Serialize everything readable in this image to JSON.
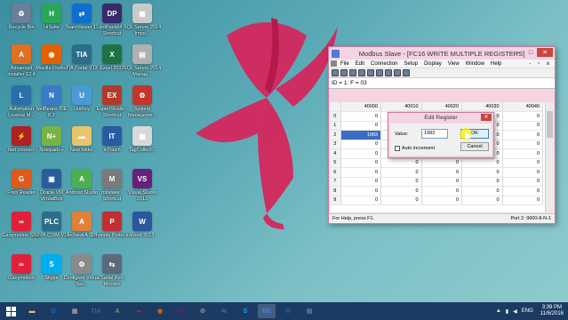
{
  "desktop": {
    "icons": [
      {
        "label": "Recycle Bin",
        "icon": "recycle-bin-icon",
        "color": "#6a7f98",
        "glyph": "♻"
      },
      {
        "label": "HiSuite",
        "icon": "hisuite-icon",
        "color": "#2aa55a",
        "glyph": "H"
      },
      {
        "label": "TeamViewer 11",
        "icon": "teamviewer-icon",
        "color": "#0e6fd1",
        "glyph": "⇄"
      },
      {
        "label": "dotPeek64 - Shortcut",
        "icon": "dotpeek-icon",
        "color": "#3a2a6a",
        "glyph": "DP"
      },
      {
        "label": "SQL Server 2014 Impo...",
        "icon": "sql-server-icon",
        "color": "#c9c9c9",
        "glyph": "▦"
      },
      {
        "label": "Advanced Installer 12.4",
        "icon": "advanced-installer-icon",
        "color": "#e07020",
        "glyph": "A"
      },
      {
        "label": "Mozilla Firefox",
        "icon": "firefox-icon",
        "color": "#e66000",
        "glyph": "◉"
      },
      {
        "label": "TIA Portal V13",
        "icon": "tia-portal-icon",
        "color": "#2d6d8a",
        "glyph": "TIA"
      },
      {
        "label": "Excel 2013",
        "icon": "excel-icon",
        "color": "#207245",
        "glyph": "X"
      },
      {
        "label": "SQL Server 2014 Manag...",
        "icon": "sql-management-icon",
        "color": "#b0b0b0",
        "glyph": "▤"
      },
      {
        "label": "Automation License M...",
        "icon": "automation-license-icon",
        "color": "#2b6fa8",
        "glyph": "L"
      },
      {
        "label": "NetBeans IDE 8.2",
        "icon": "netbeans-icon",
        "color": "#3a7bc8",
        "glyph": "N"
      },
      {
        "label": "UniKey",
        "icon": "unikey-icon",
        "color": "#4a9ad8",
        "glyph": "U"
      },
      {
        "label": "ExpertStudio - Shortcut",
        "icon": "expertstudio-icon",
        "color": "#b33a2a",
        "glyph": "EX"
      },
      {
        "label": "System Manageme...",
        "icon": "system-management-icon",
        "color": "#c4352c",
        "glyph": "⚙"
      },
      {
        "label": "fast connect",
        "icon": "fast-connect-icon",
        "color": "#b02020",
        "glyph": "⚡"
      },
      {
        "label": "Notepad++",
        "icon": "notepad-plus-icon",
        "color": "#79b346",
        "glyph": "N+"
      },
      {
        "label": "New folder",
        "icon": "folder-icon",
        "color": "#e9c46a",
        "glyph": "▬"
      },
      {
        "label": "InTouch",
        "icon": "intouch-icon",
        "color": "#2a5aa0",
        "glyph": "IT"
      },
      {
        "label": "TagCollect...",
        "icon": "tagcollect-icon",
        "color": "#d8d8d8",
        "glyph": "▦"
      },
      {
        "label": "Foxit Reader",
        "icon": "foxit-reader-icon",
        "color": "#e05a1c",
        "glyph": "G"
      },
      {
        "label": "Oracle VM VirtualBox",
        "icon": "virtualbox-icon",
        "color": "#2b5c9a",
        "glyph": "▣"
      },
      {
        "label": "Android Studio",
        "icon": "android-studio-icon",
        "color": "#4caf50",
        "glyph": "A"
      },
      {
        "label": "mbslave - Shortcut",
        "icon": "mbslave-icon",
        "color": "#7a7a7a",
        "glyph": "M"
      },
      {
        "label": "Visual Studio 2013",
        "icon": "visual-studio-icon",
        "color": "#68217a",
        "glyph": "VS"
      },
      {
        "label": "Ganymotion Shell",
        "icon": "genymotion-shell-icon",
        "color": "#e0203a",
        "glyph": "∞"
      },
      {
        "label": "S7-PLCSIM V13",
        "icon": "plcsim-icon",
        "color": "#2d6d8a",
        "glyph": "PLC"
      },
      {
        "label": "ArchestrA IDE",
        "icon": "archestra-icon",
        "color": "#e0803a",
        "glyph": "A"
      },
      {
        "label": "Phoenix Protector",
        "icon": "phoenix-protector-icon",
        "color": "#c03030",
        "glyph": "P"
      },
      {
        "label": "Word 2013",
        "icon": "word-icon",
        "color": "#2b579a",
        "glyph": "W"
      },
      {
        "label": "Ganymotion",
        "icon": "genymotion-icon",
        "color": "#e0203a",
        "glyph": "∞"
      },
      {
        "label": "Skype",
        "icon": "skype-icon",
        "color": "#00aff0",
        "glyph": "S"
      },
      {
        "label": "Configure Virtual Ser...",
        "icon": "configure-virtual-serial-icon",
        "color": "#8a8a8a",
        "glyph": "⚙"
      },
      {
        "label": "Serial Port Monitor",
        "icon": "serial-port-monitor-icon",
        "color": "#5a6a7a",
        "glyph": "⇆"
      }
    ]
  },
  "modbus": {
    "title": "Modbus Slave - [FC16 WRITE MULTIPLE REGISTERS]",
    "menu": [
      "File",
      "Edit",
      "Connection",
      "Setup",
      "Display",
      "View",
      "Window",
      "Help"
    ],
    "window_buttons": "- ▫ x",
    "id_line": "ID = 1: F = 03",
    "columns": [
      "40000",
      "40010",
      "40020",
      "40030",
      "40040"
    ],
    "rows": [
      {
        "index": "0",
        "values": [
          "0",
          "0",
          "0",
          "0",
          "0"
        ]
      },
      {
        "index": "1",
        "values": [
          "0",
          "0",
          "0",
          "0",
          "0"
        ]
      },
      {
        "index": "2",
        "values": [
          "1983",
          "0",
          "0",
          "0",
          "0"
        ]
      },
      {
        "index": "3",
        "values": [
          "0",
          "0",
          "0",
          "0",
          "0"
        ]
      },
      {
        "index": "4",
        "values": [
          "0",
          "0",
          "0",
          "0",
          "0"
        ]
      },
      {
        "index": "5",
        "values": [
          "0",
          "0",
          "0",
          "0",
          "0"
        ]
      },
      {
        "index": "6",
        "values": [
          "0",
          "0",
          "0",
          "0",
          "0"
        ]
      },
      {
        "index": "7",
        "values": [
          "0",
          "0",
          "0",
          "0",
          "0"
        ]
      },
      {
        "index": "8",
        "values": [
          "0",
          "0",
          "0",
          "0",
          "0"
        ]
      },
      {
        "index": "9",
        "values": [
          "0",
          "0",
          "0",
          "0",
          "0"
        ]
      }
    ],
    "status_left": "For Help, press F1.",
    "status_right": "Port 2: 9600-8-N-1"
  },
  "dialog": {
    "title": "Edit Register",
    "value_label": "Value:",
    "value": "1983",
    "ok_label": "OK",
    "cancel_label": "Cancel",
    "auto_increment_label": "Auto increment"
  },
  "taskbar": {
    "apps": [
      {
        "icon": "file-explorer-icon",
        "glyph": "▬",
        "color": "#e9c46a"
      },
      {
        "icon": "outlook-icon",
        "glyph": "O",
        "color": "#0072c6"
      },
      {
        "icon": "sql-server-icon",
        "glyph": "▦",
        "color": "#999"
      },
      {
        "icon": "tia-portal-icon",
        "glyph": "TIA",
        "color": "#2d6d8a"
      },
      {
        "icon": "android-studio-icon",
        "glyph": "A",
        "color": "#4caf50"
      },
      {
        "icon": "genymotion-icon",
        "glyph": "∞",
        "color": "#e0203a"
      },
      {
        "icon": "firefox-icon",
        "glyph": "◉",
        "color": "#e66000"
      },
      {
        "icon": "visual-studio-icon",
        "glyph": "VS",
        "color": "#68217a"
      },
      {
        "icon": "configure-virtual-serial-icon",
        "glyph": "⚙",
        "color": "#8a8a8a"
      },
      {
        "icon": "serial-port-monitor-icon",
        "glyph": "⇆",
        "color": "#5a6a7a"
      },
      {
        "icon": "skype-icon",
        "glyph": "S",
        "color": "#00aff0"
      },
      {
        "icon": "modbus-slave-icon",
        "glyph": "MB",
        "color": "#4c7bd6"
      },
      {
        "icon": "word-icon",
        "glyph": "W",
        "color": "#2b579a"
      },
      {
        "icon": "other-app-icon",
        "glyph": "▤",
        "color": "#6a7f98"
      }
    ],
    "language": "ENG",
    "time": "3:39 PM",
    "date": "11/6/2016"
  }
}
